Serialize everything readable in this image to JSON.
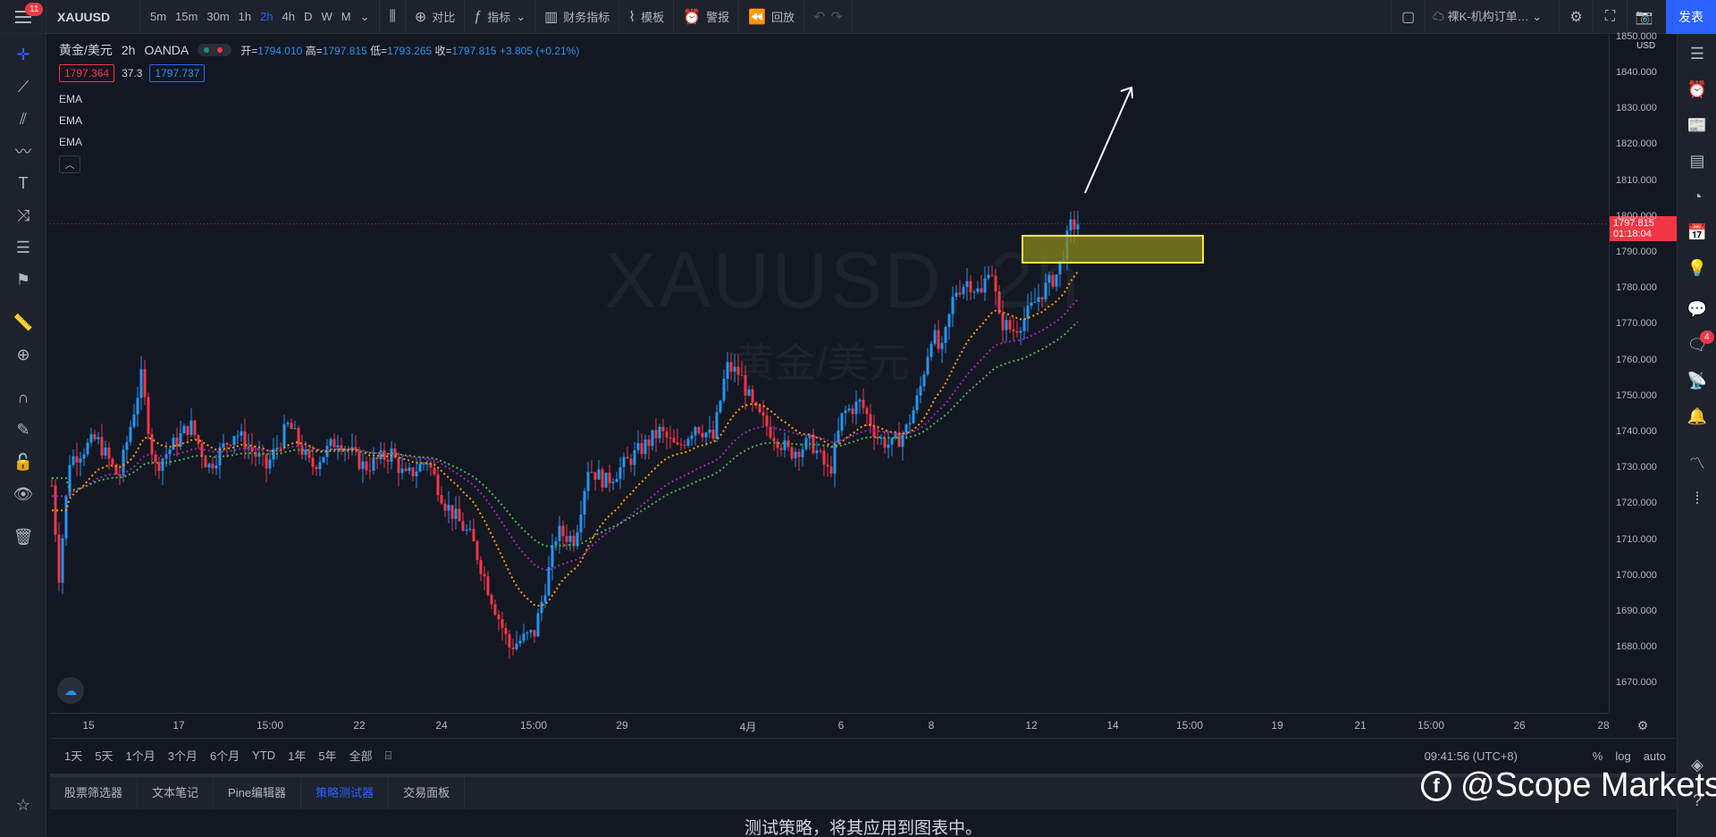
{
  "topbar": {
    "notification_count": "11",
    "symbol": "XAUUSD",
    "intervals": [
      "5m",
      "15m",
      "30m",
      "1h",
      "2h",
      "4h",
      "D",
      "W",
      "M"
    ],
    "active_interval": "2h",
    "compare_label": "对比",
    "indicators_label": "指标",
    "financials_label": "财务指标",
    "templates_label": "模板",
    "alert_label": "警报",
    "replay_label": "回放",
    "layout_name": "裸K-机构订单…",
    "publish_label": "发表"
  },
  "legend": {
    "name": "黄金/美元",
    "interval": "2h",
    "source": "OANDA",
    "open_label": "开=",
    "open": "1794.010",
    "high_label": "高=",
    "high": "1797.815",
    "low_label": "低=",
    "low": "1793.265",
    "close_label": "收=",
    "close": "1797.815",
    "change": "+3.805 (+0.21%)",
    "sell": "1797.364",
    "spread": "37.3",
    "buy": "1797.737",
    "indicators": [
      "EMA",
      "EMA",
      "EMA"
    ]
  },
  "watermark": {
    "line1": "XAUUSD, 2h",
    "line2": "黄金/美元"
  },
  "price_axis": {
    "currency": "USD",
    "ticks": [
      "1850.000",
      "1840.000",
      "1830.000",
      "1820.000",
      "1810.000",
      "1800.000",
      "1790.000",
      "1780.000",
      "1770.000",
      "1760.000",
      "1750.000",
      "1740.000",
      "1730.000",
      "1720.000",
      "1710.000",
      "1700.000",
      "1690.000",
      "1680.000",
      "1670.000"
    ],
    "current_price": "1797.815",
    "countdown": "01:18:04"
  },
  "time_axis": {
    "ticks": [
      "15",
      "17",
      "15:00",
      "22",
      "24",
      "15:00",
      "29",
      "4月",
      "6",
      "8",
      "12",
      "14",
      "15:00",
      "19",
      "21",
      "15:00",
      "26",
      "28"
    ]
  },
  "range_bar": {
    "ranges": [
      "1天",
      "5天",
      "1个月",
      "3个月",
      "6个月",
      "YTD",
      "1年",
      "5年",
      "全部"
    ],
    "clock": "09:41:56 (UTC+8)",
    "percent": "%",
    "log": "log",
    "auto": "auto"
  },
  "bottom_tabs": {
    "tabs": [
      "股票筛选器",
      "文本笔记",
      "Pine编辑器",
      "策略测试器",
      "交易面板"
    ],
    "active": "策略测试器",
    "message": "测试策略，将其应用到图表中。"
  },
  "brand": {
    "text": "@Scope Markets"
  },
  "right_bar": {
    "chat_count": "4"
  },
  "colors": {
    "up": "#2196f3",
    "down": "#f23645",
    "ema_fast": "#ff9800",
    "ema_mid": "#9c27b0",
    "ema_slow": "#4caf50",
    "zone_fill": "#8a8a1a",
    "zone_border": "#ffeb3b",
    "accent": "#2962ff"
  },
  "chart_data": {
    "type": "candlestick",
    "symbol": "XAUUSD",
    "interval": "2h",
    "ylim": [
      1665,
      1855
    ],
    "last_price": 1797.815,
    "zone": {
      "price_low": 1787,
      "price_high": 1794.5
    },
    "path": [
      [
        0,
        1725
      ],
      [
        8,
        1700
      ],
      [
        20,
        1732
      ],
      [
        50,
        1738
      ],
      [
        75,
        1727
      ],
      [
        100,
        1755
      ],
      [
        115,
        1730
      ],
      [
        155,
        1742
      ],
      [
        175,
        1730
      ],
      [
        205,
        1740
      ],
      [
        240,
        1730
      ],
      [
        265,
        1742
      ],
      [
        290,
        1730
      ],
      [
        320,
        1738
      ],
      [
        350,
        1730
      ],
      [
        380,
        1734
      ],
      [
        395,
        1727
      ],
      [
        420,
        1732
      ],
      [
        440,
        1720
      ],
      [
        470,
        1710
      ],
      [
        490,
        1695
      ],
      [
        512,
        1680
      ],
      [
        540,
        1684
      ],
      [
        555,
        1700
      ],
      [
        565,
        1712
      ],
      [
        585,
        1710
      ],
      [
        600,
        1730
      ],
      [
        620,
        1726
      ],
      [
        650,
        1733
      ],
      [
        680,
        1740
      ],
      [
        700,
        1735
      ],
      [
        720,
        1742
      ],
      [
        740,
        1738
      ],
      [
        755,
        1758
      ],
      [
        770,
        1756
      ],
      [
        785,
        1746
      ],
      [
        805,
        1740
      ],
      [
        825,
        1734
      ],
      [
        850,
        1737
      ],
      [
        870,
        1728
      ],
      [
        885,
        1745
      ],
      [
        905,
        1748
      ],
      [
        925,
        1738
      ],
      [
        940,
        1736
      ],
      [
        955,
        1740
      ],
      [
        970,
        1750
      ],
      [
        985,
        1768
      ],
      [
        995,
        1761
      ],
      [
        1010,
        1779
      ],
      [
        1025,
        1782
      ],
      [
        1040,
        1778
      ],
      [
        1050,
        1788
      ],
      [
        1060,
        1771
      ],
      [
        1075,
        1768
      ],
      [
        1090,
        1772
      ],
      [
        1105,
        1778
      ],
      [
        1125,
        1784
      ],
      [
        1140,
        1797
      ],
      [
        1148,
        1798
      ]
    ]
  }
}
